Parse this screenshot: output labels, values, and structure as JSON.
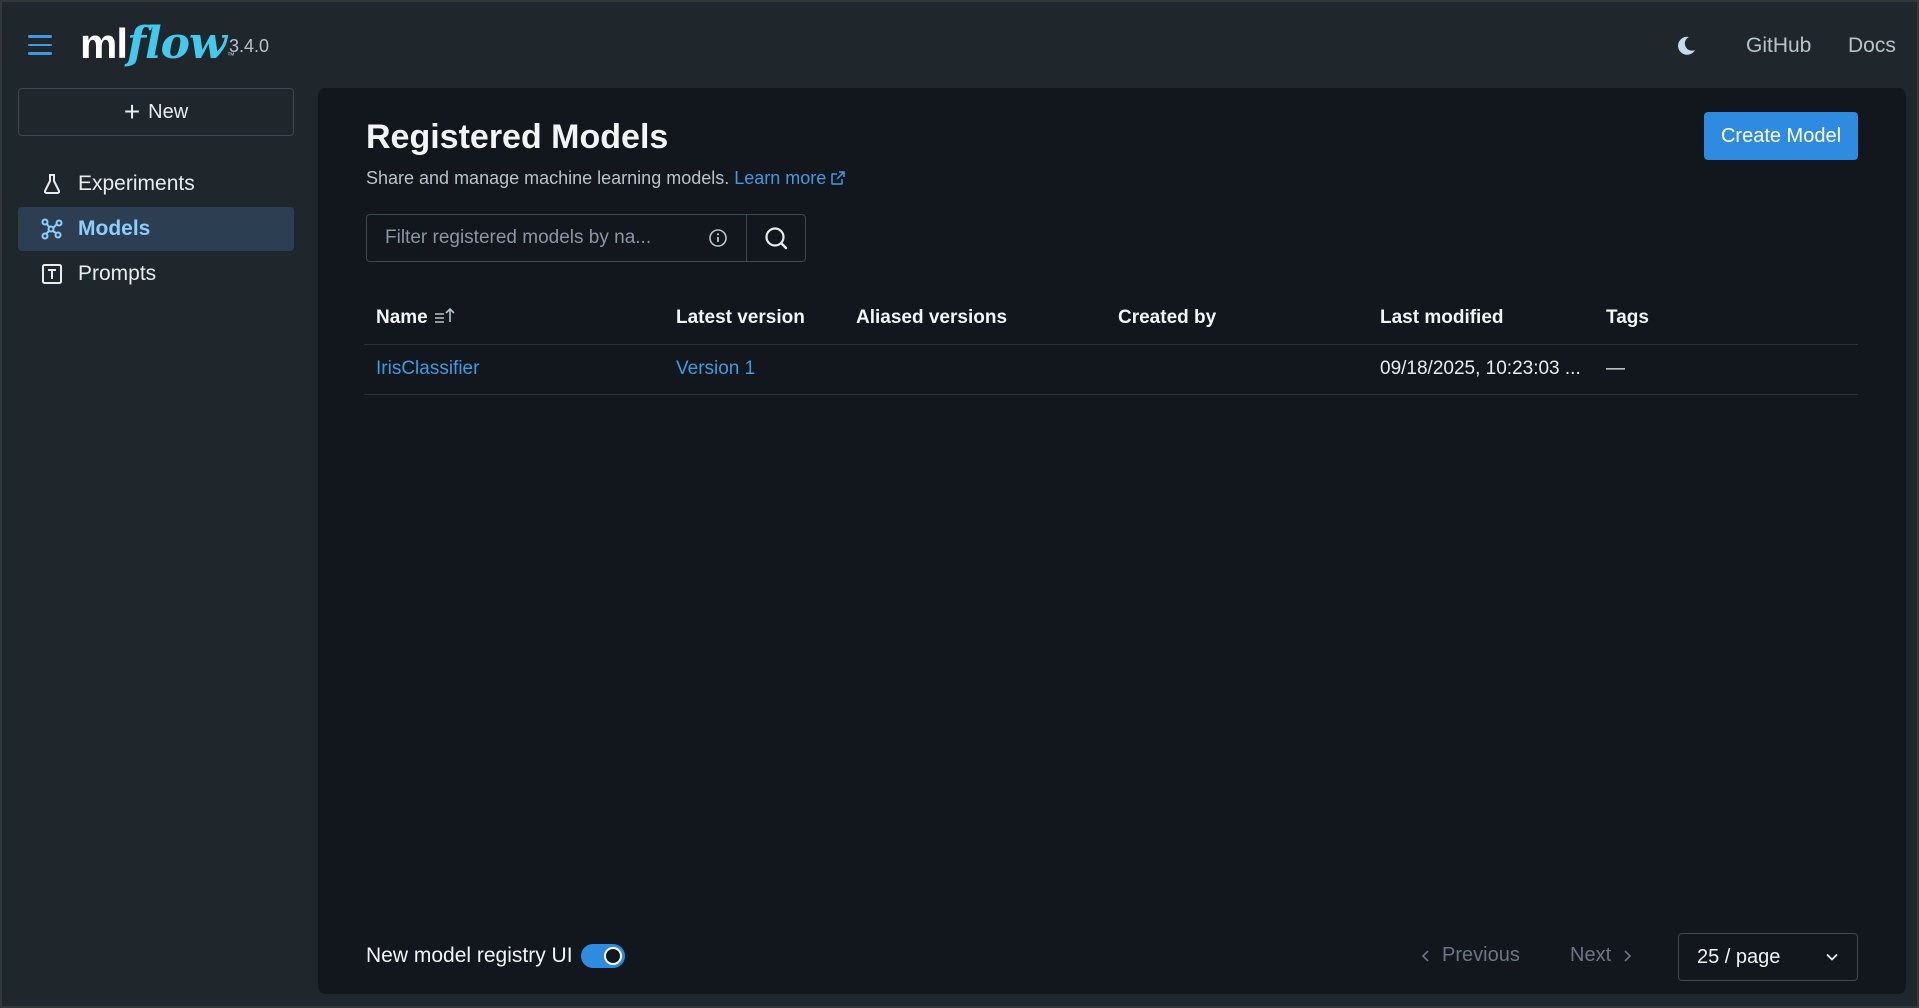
{
  "header": {
    "logo_ml": "ml",
    "logo_flow": "flow",
    "version": "3.4.0",
    "links": [
      "GitHub",
      "Docs"
    ]
  },
  "sidebar": {
    "new_label": "New",
    "items": [
      {
        "label": "Experiments",
        "icon": "flask-icon",
        "active": false
      },
      {
        "label": "Models",
        "icon": "models-icon",
        "active": true
      },
      {
        "label": "Prompts",
        "icon": "prompt-icon",
        "active": false
      }
    ]
  },
  "main": {
    "title": "Registered Models",
    "subtitle": "Share and manage machine learning models.",
    "learn_more": "Learn more",
    "create_button": "Create Model",
    "search": {
      "placeholder": "Filter registered models by na..."
    },
    "table": {
      "columns": [
        "Name",
        "Latest version",
        "Aliased versions",
        "Created by",
        "Last modified",
        "Tags"
      ],
      "rows": [
        {
          "name": "IrisClassifier",
          "latest_version": "Version 1",
          "aliased_versions": "",
          "created_by": "",
          "last_modified": "09/18/2025, 10:23:03 ...",
          "tags": "—"
        }
      ]
    },
    "footer": {
      "toggle_label": "New model registry UI",
      "toggle_on": true,
      "previous": "Previous",
      "next": "Next",
      "page_size": "25 / page"
    }
  },
  "colors": {
    "accent": "#2f8be0",
    "link": "#4299e0",
    "background": "#1f272d",
    "panel": "#11171c"
  }
}
